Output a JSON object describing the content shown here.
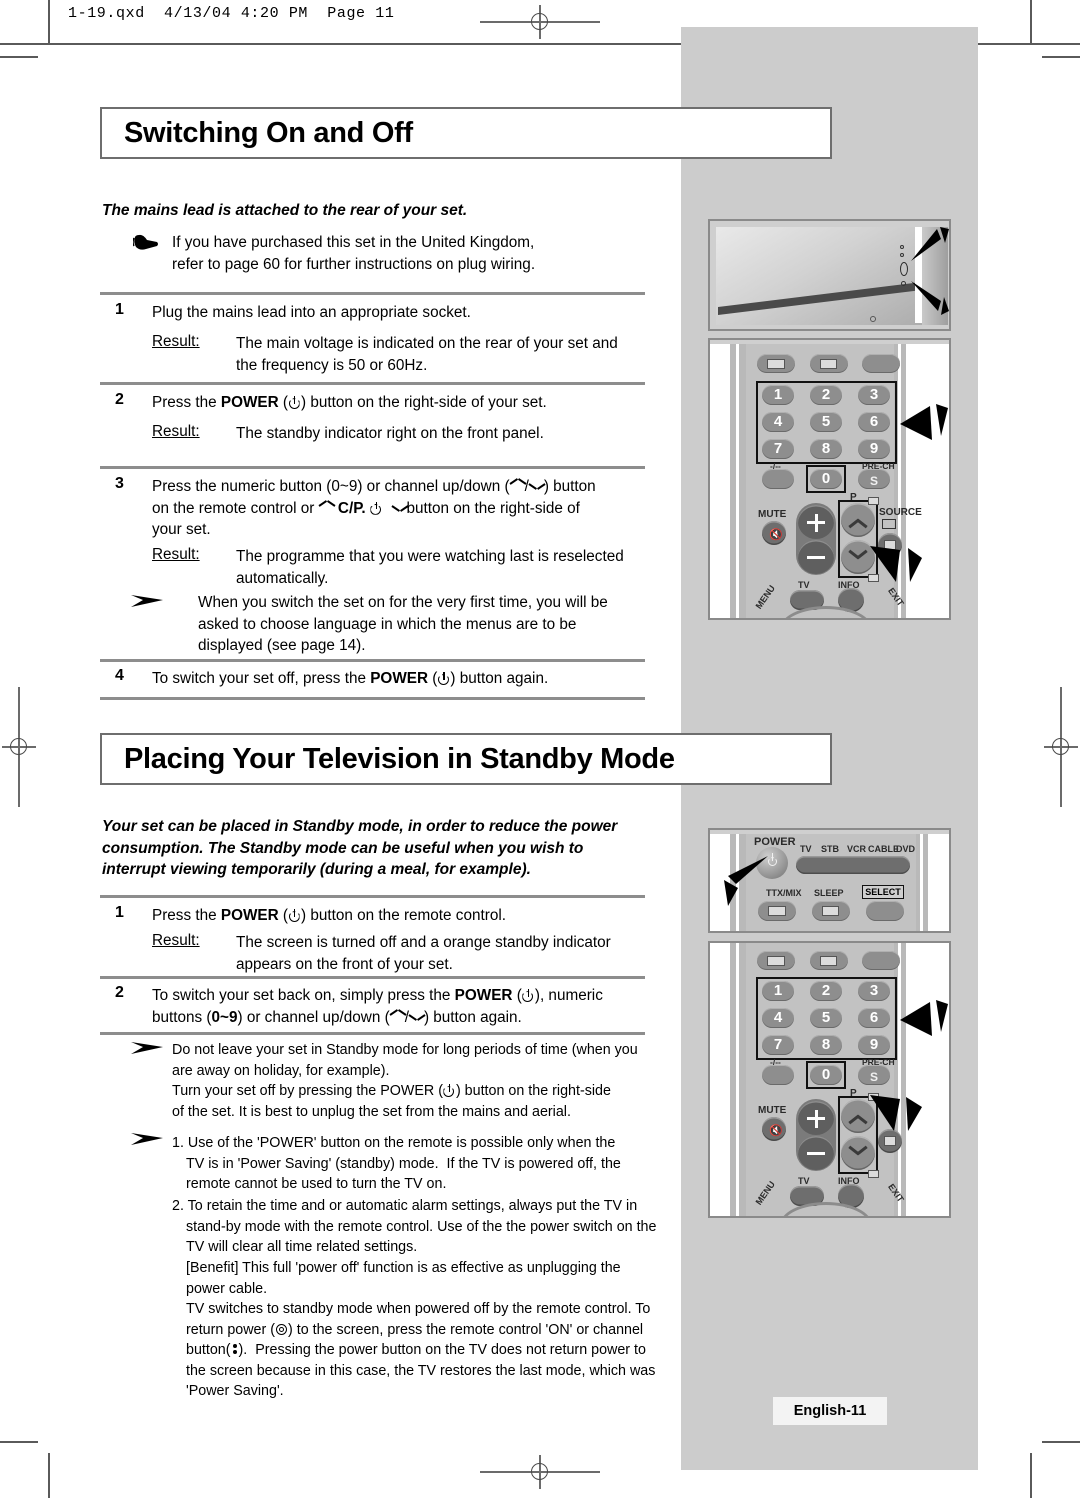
{
  "print_header": "1-19.qxd  4/13/04 4:20 PM  Page 11",
  "footer": {
    "badge": "English-11"
  },
  "sections": [
    {
      "id": "switching",
      "title": "Switching On and Off",
      "intro": "The mains lead is attached to the rear of your set.",
      "hand_note": "If you have purchased this set in the United Kingdom,\nrefer to page 60 for further instructions on plug wiring.",
      "steps": [
        {
          "num": "1",
          "text": "Plug the mains lead into an appropriate socket.",
          "result_label": "Result:",
          "result_text": "The main voltage is indicated on the rear of your set and\nthe frequency is 50 or 60Hz."
        },
        {
          "num": "2",
          "text_pre": "Press the ",
          "text_bold": "POWER",
          "text_post": " button on the right-side of your set.",
          "result_label": "Result:",
          "result_text": "The standby indicator right on the front panel."
        },
        {
          "num": "3",
          "text_a": "Press the numeric button (0~9) or channel up/down (",
          "text_b": ") button",
          "text_c": "on the remote control or",
          "text_d": "C/P.",
          "text_e": "button on the right-side of",
          "text_f": "your set.",
          "result_label": "Result:",
          "result_text": "The programme that you were watching last is reselected\nautomatically."
        },
        {
          "num": "4",
          "text_pre": "To switch your set off, press the ",
          "text_bold": "POWER",
          "text_post": " button again."
        }
      ],
      "arrow_note": "When you switch the set on for the very first time, you will be\nasked to choose language in which the menus are to be\ndisplayed (see page 14)."
    },
    {
      "id": "standby",
      "title": "Placing Your Television in Standby Mode",
      "intro": "Your set can be placed in Standby mode, in order to reduce the power\nconsumption. The Standby mode can be useful when you wish to\ninterrupt viewing temporarily (during a meal, for example).",
      "steps": [
        {
          "num": "1",
          "text_pre": "Press the ",
          "text_bold": "POWER",
          "text_post": " button on the remote control.",
          "result_label": "Result:",
          "result_text": "The screen is turned off and a orange standby indicator\nappears on the front of your set."
        },
        {
          "num": "2",
          "text_a": "To switch your set back on, simply press the ",
          "text_bold": "POWER",
          "text_b": ", numeric",
          "text_c": "buttons (",
          "text_bold2": "0~9",
          "text_d": ") or channel up/down (",
          "text_e": ") button again."
        }
      ],
      "notes": [
        {
          "lines": [
            "Do not leave your set in Standby mode for long periods of time (when you",
            "are away on holiday, for example).",
            "Turn your set off by pressing the POWER (⏻) button on the right-side",
            "of the set. It is best to unplug the set from the mains and aerial."
          ]
        },
        {
          "items": [
            "1. Use of the 'POWER' button on the remote is possible only when the\nTV is in 'Power Saving' (standby) mode.  If the TV is powered off, the\nremote cannot be used to turn the TV on.",
            "2. To retain the time and or automatic alarm settings, always put the TV in\nstand-by mode with the remote control. Use of the the power switch on the\nTV will clear all time related settings."
          ],
          "tail": [
            "[Benefit] This full 'power off' function is as effective as unplugging the",
            "power cable.",
            "TV switches to standby mode when powered off by the remote control. To",
            "return power (◎) to the screen, press the remote control 'ON' or channel",
            "button(⁝).  Pressing the power button on the TV does not return power to",
            "the screen because in this case, the TV restores the last mode, which was",
            "'Power Saving'."
          ]
        }
      ]
    }
  ],
  "illustrations": {
    "tv_rear": {
      "name": "tv-rear-side-view"
    },
    "remote_top": {
      "keys_numeric": [
        "1",
        "2",
        "3",
        "4",
        "5",
        "6",
        "7",
        "8",
        "9",
        "0"
      ],
      "label_prech": "PRE-CH",
      "label_dashes": "-/--",
      "label_mute": "MUTE",
      "label_p": "P",
      "label_source": "SOURCE",
      "label_tv": "TV",
      "label_info": "INFO",
      "label_menu": "MENU",
      "label_exit": "EXIT"
    },
    "remote_power": {
      "label_power": "POWER",
      "modes": [
        "TV",
        "STB",
        "VCR",
        "CABLE",
        "DVD"
      ],
      "label_ttx": "TTX/MIX",
      "label_sleep": "SLEEP",
      "label_select": "SELECT"
    },
    "remote_bottom": {
      "keys_numeric": [
        "1",
        "2",
        "3",
        "4",
        "5",
        "6",
        "7",
        "8",
        "9",
        "0"
      ],
      "label_prech": "PRE-CH",
      "label_dashes": "-/--",
      "label_mute": "MUTE",
      "label_p": "P",
      "label_tv": "TV",
      "label_info": "INFO",
      "label_menu": "MENU",
      "label_exit": "EXIT"
    }
  },
  "colors": {
    "panel_gray": "#cccccc",
    "rule_gray": "#8d8d8d",
    "banner_border": "#6e6e6e"
  }
}
